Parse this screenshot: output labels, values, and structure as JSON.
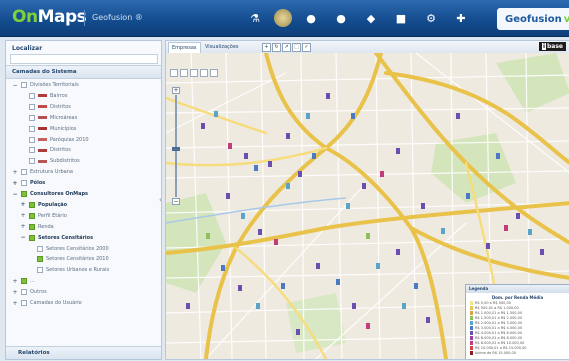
{
  "app": {
    "logo_on": "On",
    "logo_maps": "Maps",
    "product": "Geofusion ®",
    "brand": "Geofusion",
    "brand_mark": "v"
  },
  "toolbar": {
    "icons": [
      "flask-icon",
      "globe-icon",
      "pin-icon",
      "pin-icon",
      "layers-icon",
      "lock-icon",
      "settings-icon",
      "arrow-icon"
    ]
  },
  "left_panel": {
    "search_label": "Localizar",
    "layers_header": "Camadas do Sistema",
    "tree": [
      {
        "label": "Divisões Territoriais",
        "level": 0,
        "bold": false,
        "toggle": "−",
        "checked": false
      },
      {
        "label": "Bairros",
        "level": 1,
        "legend": "#b23a3a"
      },
      {
        "label": "Distritos",
        "level": 1,
        "legend": "#c24a4a"
      },
      {
        "label": "Microáreas",
        "level": 1,
        "legend": "#b85050"
      },
      {
        "label": "Municípios",
        "level": 1,
        "legend": "#a83232"
      },
      {
        "label": "Paróquias 2010",
        "level": 1,
        "legend": "#c46060"
      },
      {
        "label": "Distritos",
        "level": 1,
        "legend": "#ad3c3c"
      },
      {
        "label": "Subdistritos",
        "level": 1,
        "legend": "#bb5555"
      },
      {
        "label": "Estrutura Urbana",
        "level": 0,
        "bold": false,
        "toggle": "+",
        "checked": false
      },
      {
        "label": "Pólos",
        "level": 0,
        "bold": true,
        "toggle": "+",
        "checked": false
      },
      {
        "label": "Consultores OnMaps",
        "level": 0,
        "bold": true,
        "toggle": "−",
        "checked": true
      },
      {
        "label": "População",
        "level": 1,
        "bold": true,
        "toggle": "+",
        "checked": true
      },
      {
        "label": "Perfil Etário",
        "level": 1,
        "bold": false,
        "toggle": "+",
        "checked": true
      },
      {
        "label": "Renda",
        "level": 1,
        "bold": false,
        "toggle": "+",
        "checked": true
      },
      {
        "label": "Setores Censitários",
        "level": 1,
        "bold": true,
        "toggle": "−",
        "checked": true
      },
      {
        "label": "Setores Censitários 2000",
        "level": 2,
        "checked": false
      },
      {
        "label": "Setores Censitários 2010",
        "level": 2,
        "checked": true
      },
      {
        "label": "Setores Urbanos e Rurais",
        "level": 2,
        "checked": false
      },
      {
        "label": "...",
        "level": 0,
        "bold": false,
        "toggle": "+",
        "checked": true
      },
      {
        "label": "Outros",
        "level": 0,
        "bold": false,
        "toggle": "+",
        "checked": false
      },
      {
        "label": "Camadas do Usuário",
        "level": 0,
        "bold": false,
        "toggle": "+",
        "checked": false
      }
    ],
    "bottom_label": "Relatórios"
  },
  "map_panel": {
    "tab_active": "Empresas",
    "tab_2": "Visualizações",
    "mini_tools": [
      "+",
      "↻",
      "↗",
      "⬚",
      "✓"
    ],
    "ibase_prefix": "i",
    "ibase_label": "base",
    "zoom_in": "+",
    "zoom_out": "−"
  },
  "legend": {
    "header": "Legenda",
    "title": "Dom. por Renda Média",
    "items": [
      {
        "label": "R$ 0,00 a R$ 500,00",
        "color": "#f2e68a"
      },
      {
        "label": "R$ 500,01 a R$ 1.000,00",
        "color": "#e6c85a"
      },
      {
        "label": "R$ 1.000,01 a R$ 1.500,00",
        "color": "#d7a345"
      },
      {
        "label": "R$ 1.500,01 a R$ 2.000,00",
        "color": "#8fbf5a"
      },
      {
        "label": "R$ 2.000,01 a R$ 3.000,00",
        "color": "#5aa4c8"
      },
      {
        "label": "R$ 3.000,01 a R$ 4.000,00",
        "color": "#4b79c2"
      },
      {
        "label": "R$ 4.000,01 a R$ 6.000,00",
        "color": "#6a4fb0"
      },
      {
        "label": "R$ 6.000,01 a R$ 8.000,00",
        "color": "#9a3fa6"
      },
      {
        "label": "R$ 8.000,01 a R$ 10.000,00",
        "color": "#c23b7a"
      },
      {
        "label": "R$ 10.000,01 a R$ 15.000,00",
        "color": "#d64545"
      },
      {
        "label": "Acima de R$ 15.000,00",
        "color": "#8a1f1f"
      }
    ]
  },
  "colors": {
    "header_blue": "#134b8d",
    "logo_green": "#7fd13b",
    "road_yellow": "#f0d060",
    "road_white": "#ffffff",
    "park_green": "#cfe2b4"
  }
}
